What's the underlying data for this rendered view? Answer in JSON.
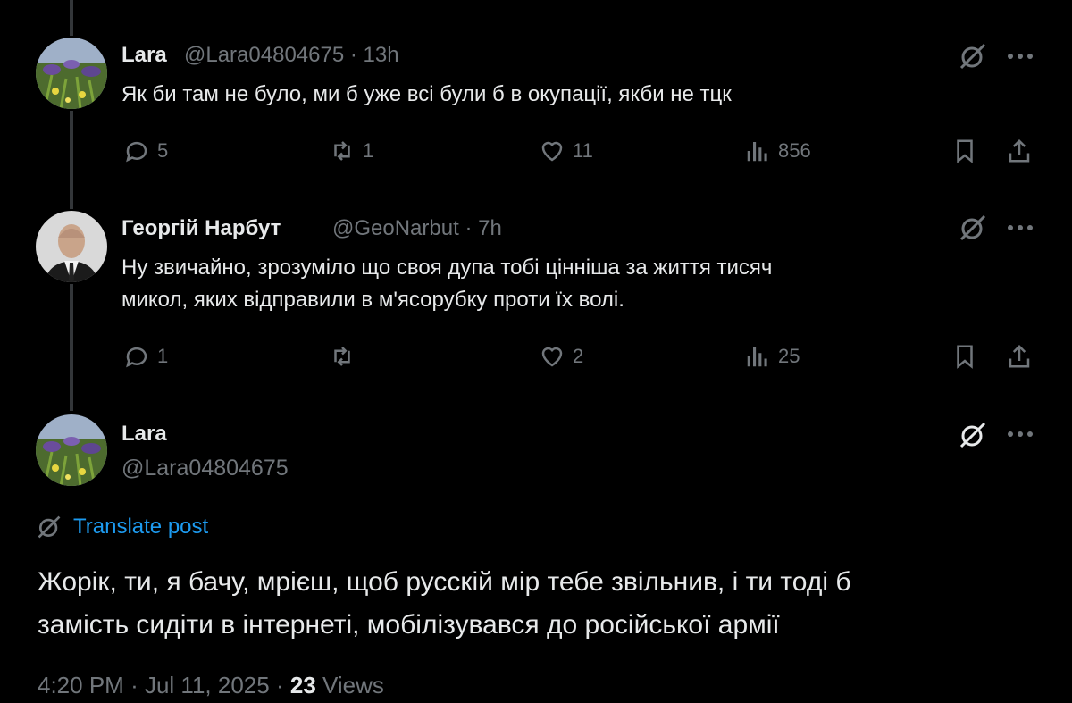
{
  "thread": [
    {
      "name": "Lara",
      "handle": "@Lara04804675",
      "time": "13h",
      "text": "Як би там не було, ми б уже всі були б в окупації, якби не тцк",
      "replies": "5",
      "reposts": "1",
      "likes": "11",
      "views": "856"
    },
    {
      "name": "Георгій Нарбут",
      "handle": "@GeoNarbut",
      "time": "7h",
      "text_line1": "Ну звичайно, зрозуміло що своя дупа тобі цінніша за життя тисяч",
      "text_line2": "микол, яких відправили в м'ясорубку проти їх волі.",
      "replies": "1",
      "reposts": "",
      "likes": "2",
      "views": "25"
    }
  ],
  "main_post": {
    "name": "Lara",
    "handle": "@Lara04804675",
    "translate_label": "Translate post",
    "text_line1": "Жорік, ти, я бачу, мрієш, щоб русскій мір тебе звільнив, і ти тоді б",
    "text_line2": "замість сидіти в інтернеті, мобілізувався до російської армії",
    "time": "4:20 PM",
    "date": "Jul 11, 2025",
    "views_count": "23",
    "views_label": "Views"
  },
  "separator": "·",
  "icons": [
    "reply-icon",
    "repost-icon",
    "like-icon",
    "views-icon",
    "bookmark-icon",
    "share-icon",
    "grok-icon",
    "more-icon",
    "translate-icon"
  ],
  "colors": {
    "background": "#000000",
    "text": "#e7e9ea",
    "muted": "#71767b",
    "link": "#1d9bf0",
    "thread_line": "#333639"
  }
}
